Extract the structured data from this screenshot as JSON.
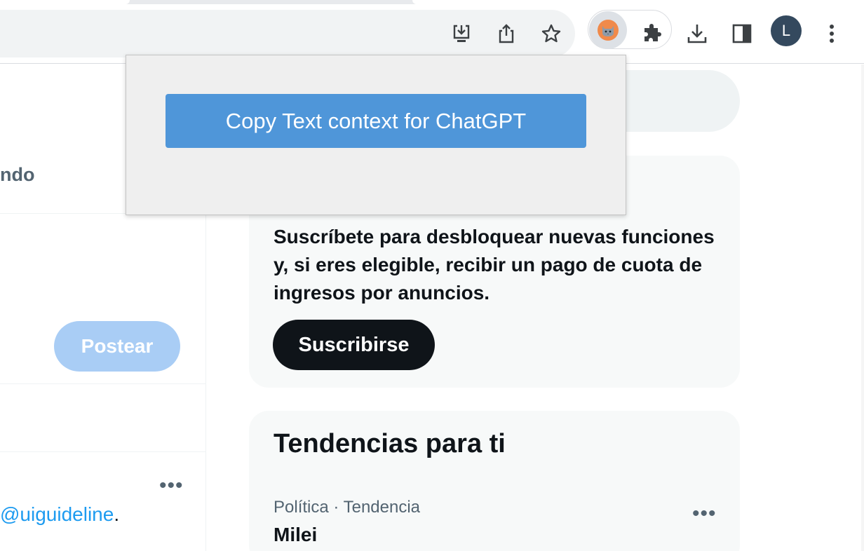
{
  "browser": {
    "profile_initial": "L",
    "icons": {
      "install": "install-app-icon",
      "share": "share-icon",
      "bookmark": "star-icon",
      "extension_active": "cat-extension-icon",
      "extensions": "puzzle-icon",
      "downloads": "download-icon",
      "side_panel": "side-panel-icon",
      "menu": "kebab-menu-icon"
    }
  },
  "extension_popup": {
    "button_label": "Copy Text context for ChatGPT"
  },
  "left_column": {
    "trending_tab_partial": "ndo",
    "post_button": "Postear",
    "more_label": "•••",
    "mention_handle": "@uiguideline",
    "mention_suffix": "."
  },
  "premium": {
    "description": "Suscríbete para desbloquear nuevas funciones y, si eres elegible, recibir un pago de cuota de ingresos por anuncios.",
    "subscribe_button": "Suscribirse"
  },
  "trends": {
    "title": "Tendencias para ti",
    "items": [
      {
        "meta": "Política · Tendencia",
        "name": "Milei",
        "more": "•••"
      }
    ]
  },
  "colors": {
    "popup_button": "#4f96d9",
    "post_button_disabled": "#a9cdf5",
    "link": "#1d9bf0",
    "subscribe_button": "#0f1419",
    "avatar": "#34495e"
  }
}
